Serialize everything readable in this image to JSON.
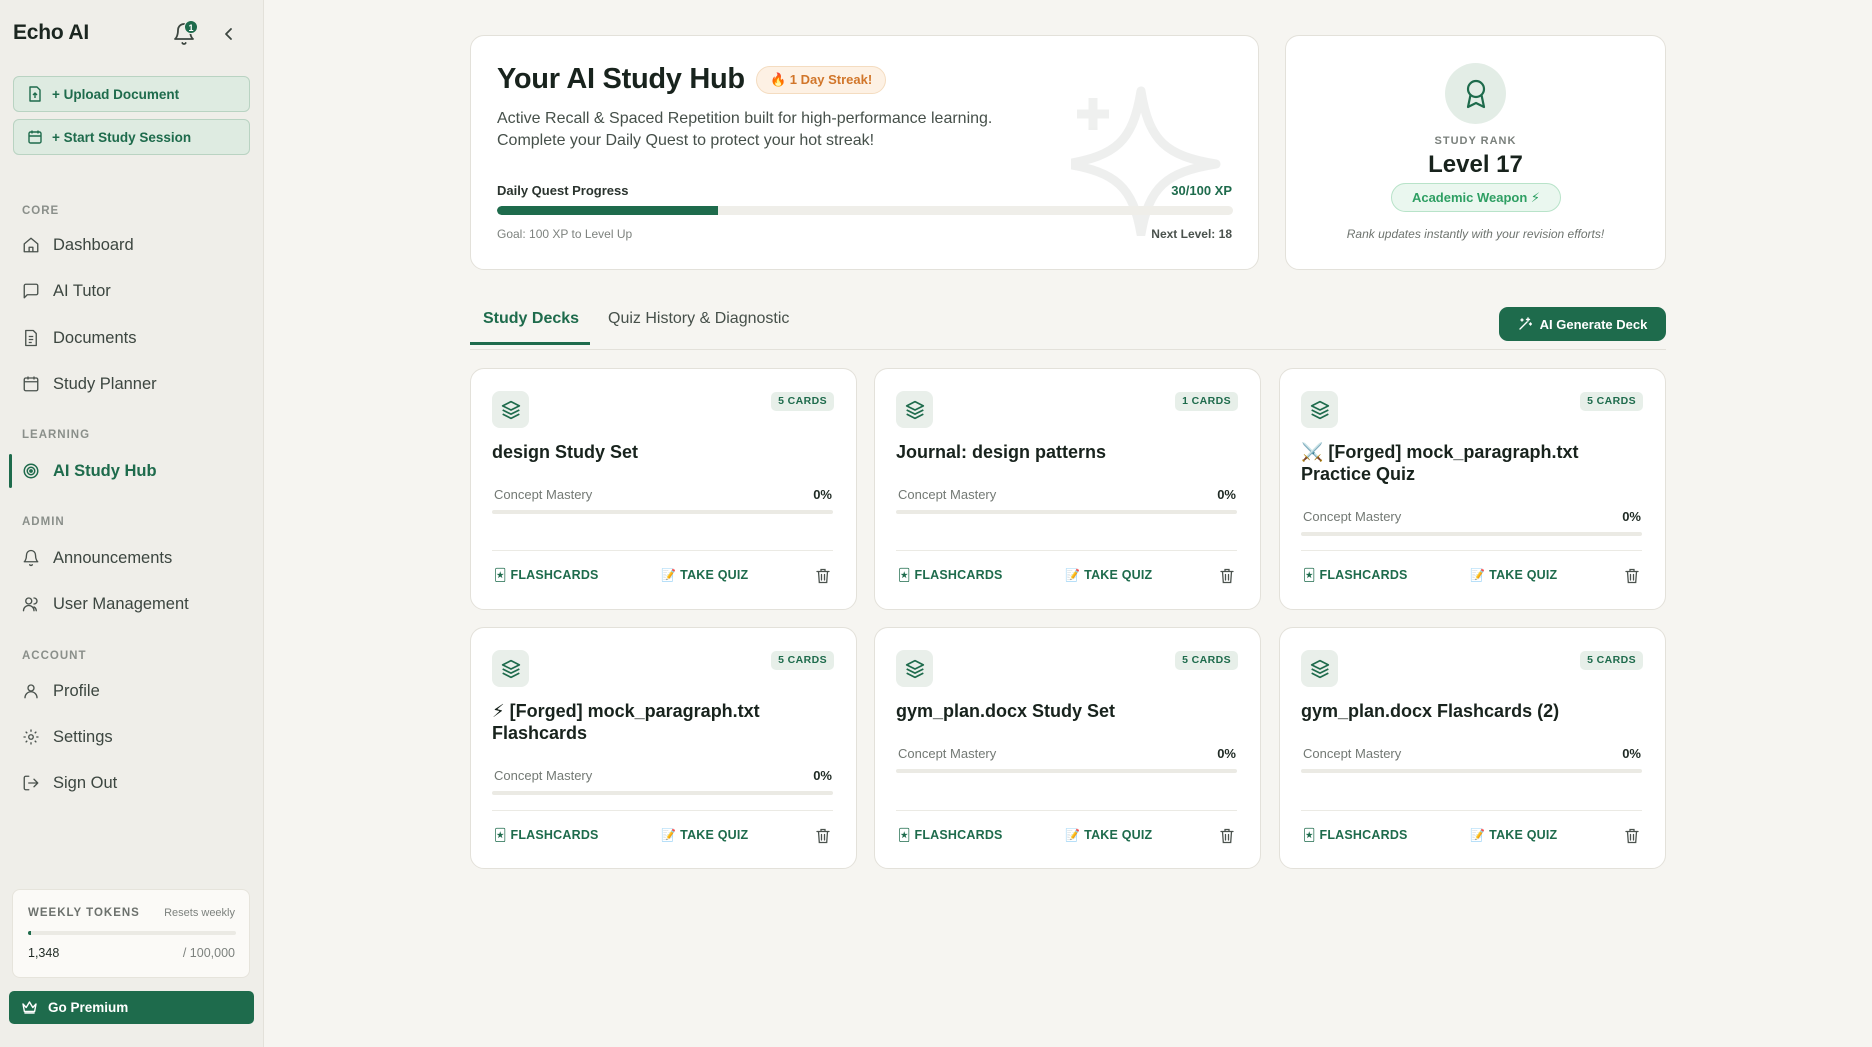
{
  "app": {
    "name": "Echo AI",
    "notification_count": "1"
  },
  "sidebar": {
    "actions": [
      {
        "label": "+ Upload Document"
      },
      {
        "label": "+ Start Study Session"
      }
    ],
    "sections": {
      "core": "CORE",
      "learning": "LEARNING",
      "admin": "ADMIN",
      "account": "ACCOUNT"
    },
    "items": {
      "dashboard": "Dashboard",
      "ai_tutor": "AI Tutor",
      "documents": "Documents",
      "study_planner": "Study Planner",
      "ai_study_hub": "AI Study Hub",
      "announcements": "Announcements",
      "user_management": "User Management",
      "profile": "Profile",
      "settings": "Settings",
      "sign_out": "Sign Out"
    },
    "active_item": "AI Study Hub",
    "tokens": {
      "title": "WEEKLY TOKENS",
      "reset_note": "Resets weekly",
      "used": "1,348",
      "limit": "/ 100,000",
      "used_fraction": 0.01348
    },
    "premium_label": "Go Premium"
  },
  "hero": {
    "title": "Your AI Study Hub",
    "streak": "🔥 1 Day Streak!",
    "description": "Active Recall & Spaced Repetition built for high-performance learning. Complete your Daily Quest to protect your hot streak!",
    "quest_label": "Daily Quest Progress",
    "quest_xp": "30/100 XP",
    "quest_fraction": 0.3,
    "goal": "Goal: 100 XP to Level Up",
    "next_level": "Next Level: 18"
  },
  "rank": {
    "label": "STUDY RANK",
    "level": "Level 17",
    "badge": "Academic Weapon ⚡",
    "note": "Rank updates instantly with your revision efforts!"
  },
  "tabs": [
    {
      "label": "Study Decks",
      "active": true
    },
    {
      "label": "Quiz History & Diagnostic",
      "active": false
    }
  ],
  "generate_button": "AI Generate Deck",
  "deck_labels": {
    "mastery": "Concept Mastery",
    "flashcards": "FLASHCARDS",
    "take_quiz": "TAKE QUIZ"
  },
  "decks": [
    {
      "title": "design Study Set",
      "count": "5 CARDS",
      "mastery": "0%",
      "mastery_fraction": 0
    },
    {
      "title": "Journal: design patterns",
      "count": "1 CARDS",
      "mastery": "0%",
      "mastery_fraction": 0
    },
    {
      "title": "⚔️ [Forged] mock_paragraph.txt Practice Quiz",
      "count": "5 CARDS",
      "mastery": "0%",
      "mastery_fraction": 0
    },
    {
      "title": "⚡ [Forged] mock_paragraph.txt Flashcards",
      "count": "5 CARDS",
      "mastery": "0%",
      "mastery_fraction": 0
    },
    {
      "title": "gym_plan.docx Study Set",
      "count": "5 CARDS",
      "mastery": "0%",
      "mastery_fraction": 0
    },
    {
      "title": "gym_plan.docx Flashcards (2)",
      "count": "5 CARDS",
      "mastery": "0%",
      "mastery_fraction": 0
    }
  ],
  "colors": {
    "primary": "#1e6b4c",
    "background": "#f6f5f1",
    "sidebar": "#efeee9",
    "streak": "#d1762a",
    "rank_badge": "#2e9f63"
  }
}
